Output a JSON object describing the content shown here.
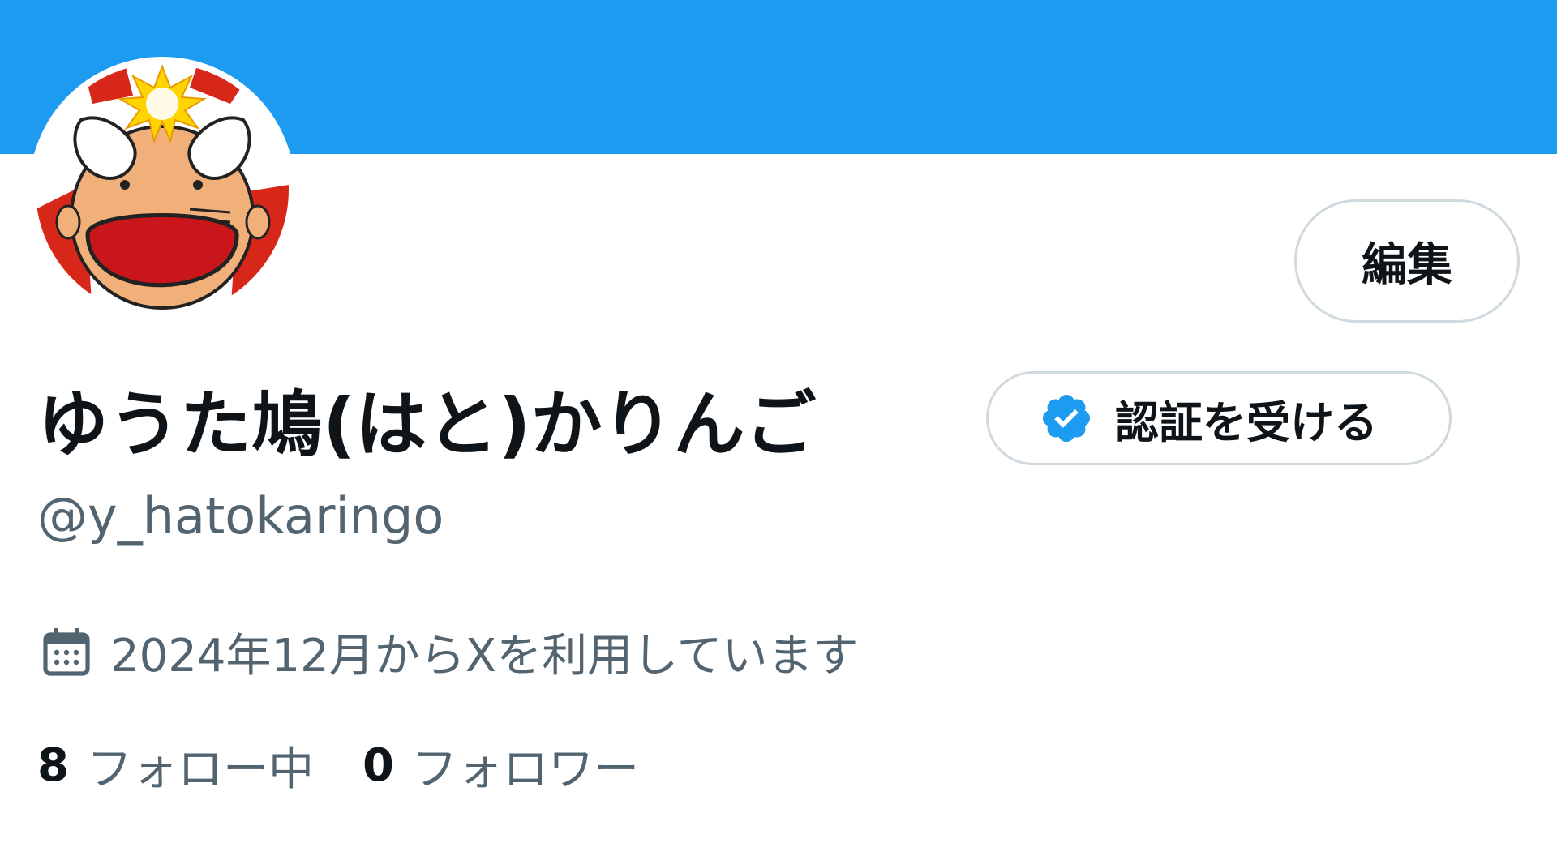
{
  "colors": {
    "banner": "#1d9bf0",
    "primary_text": "#0f1419",
    "secondary_text": "#536471",
    "border": "#cfd9de",
    "verified_blue": "#1d9bf0"
  },
  "profile": {
    "display_name": "ゆうた鳩(はと)かりんご",
    "handle": "@y_hatokaringo",
    "edit_label": "編集",
    "verify_label": "認証を受ける",
    "joined_text": "2024年12月からXを利用しています",
    "following_count": "8",
    "following_label": "フォロー中",
    "followers_count": "0",
    "followers_label": "フォロワー"
  },
  "icons": {
    "verify": "verified-badge-icon",
    "joined": "calendar-icon"
  }
}
